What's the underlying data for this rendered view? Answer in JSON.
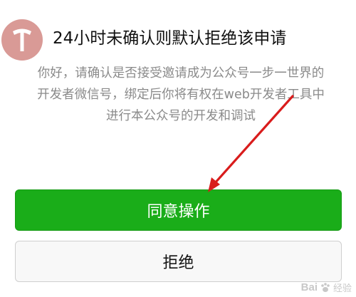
{
  "header": {
    "avatar_letter": "T",
    "avatar_color": "#d99a96",
    "title": "24小时未确认则默认拒绝该申请"
  },
  "description": {
    "lines": [
      "你好，请确认是否接受邀请成为公众号一步一世界的",
      "开发者微信号，绑定后你将有权在web开发者工具中",
      "进行本公众号的开发和调试"
    ]
  },
  "actions": {
    "agree_label": "同意操作",
    "reject_label": "拒绝"
  },
  "colors": {
    "agree_bg": "#1aad19",
    "reject_bg": "#f8f8f8",
    "annotation_arrow": "#d91c1c"
  },
  "annotation": {
    "icon": "red-arrow-icon"
  },
  "watermark": {
    "brand": "Bai",
    "paw_icon": "paw-icon",
    "suffix": "经验"
  }
}
